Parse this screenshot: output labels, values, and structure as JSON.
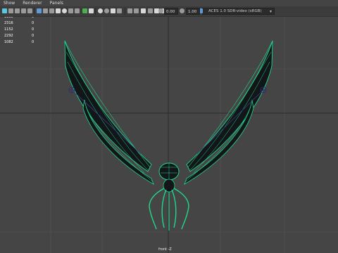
{
  "menu": {
    "items": [
      "Show",
      "Renderer",
      "Panels"
    ]
  },
  "toolbar": {
    "field_a": "0.00",
    "field_b": "1.00",
    "colorspace": "ACES 1.0 SDR-video (sRGB)",
    "icon_colors": {
      "cyan": "#5ac8e0",
      "gray": "#9a9a9a",
      "white": "#d8d8d8",
      "green": "#4caf50",
      "blue": "#5f9bd6",
      "yellow": "#c6b03c"
    }
  },
  "hud": {
    "rows": [
      {
        "a": "1188",
        "b": "0"
      },
      {
        "a": "2316",
        "b": "0"
      },
      {
        "a": "1152",
        "b": "0"
      },
      {
        "a": "2292",
        "b": "0"
      },
      {
        "a": "1082",
        "b": "0"
      }
    ]
  },
  "camera_label": "front -Z",
  "colors": {
    "viewport_bg": "#454545",
    "grid": "#5a5a5a",
    "axis": "#2c2c2c",
    "wire": "#19d98a",
    "mesh_fill": "#101418"
  }
}
